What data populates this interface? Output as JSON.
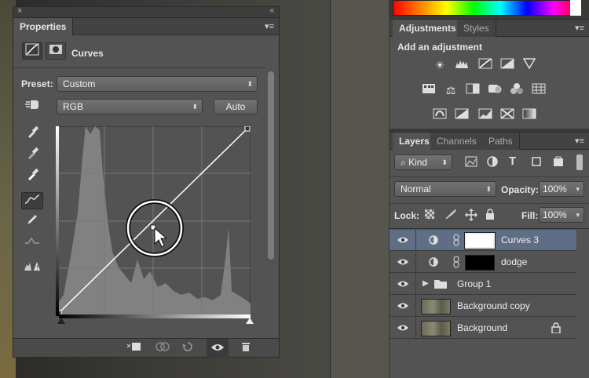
{
  "properties": {
    "tab_label": "Properties",
    "adjustment_name": "Curves",
    "preset_label": "Preset:",
    "preset_value": "Custom",
    "channel_value": "RGB",
    "auto_label": "Auto",
    "close_glyph": "×",
    "collapse_glyph": "«",
    "menu_glyph": "▾≡",
    "dropdown_arrow": "⬍"
  },
  "adjustments": {
    "tabs": [
      {
        "label": "Adjustments"
      },
      {
        "label": "Styles"
      }
    ],
    "title": "Add an adjustment"
  },
  "layers_panel": {
    "tabs": [
      {
        "label": "Layers"
      },
      {
        "label": "Channels"
      },
      {
        "label": "Paths"
      }
    ],
    "filter_kind": "Kind",
    "blend_mode": "Normal",
    "opacity_label": "Opacity:",
    "opacity_value": "100%",
    "lock_label": "Lock:",
    "fill_label": "Fill:",
    "fill_value": "100%",
    "layers": [
      {
        "name": "Curves 3",
        "type": "adjustment",
        "selected": true
      },
      {
        "name": "dodge",
        "type": "adjustment",
        "selected": false
      },
      {
        "name": "Group 1",
        "type": "group",
        "selected": false
      },
      {
        "name": "Background copy",
        "type": "image",
        "selected": false
      },
      {
        "name": "Background",
        "type": "image",
        "locked": true,
        "selected": false
      }
    ]
  },
  "colors": {
    "panel_bg": "#535353",
    "selected_layer": "#5f6e86",
    "accent_white": "#ffffff"
  }
}
